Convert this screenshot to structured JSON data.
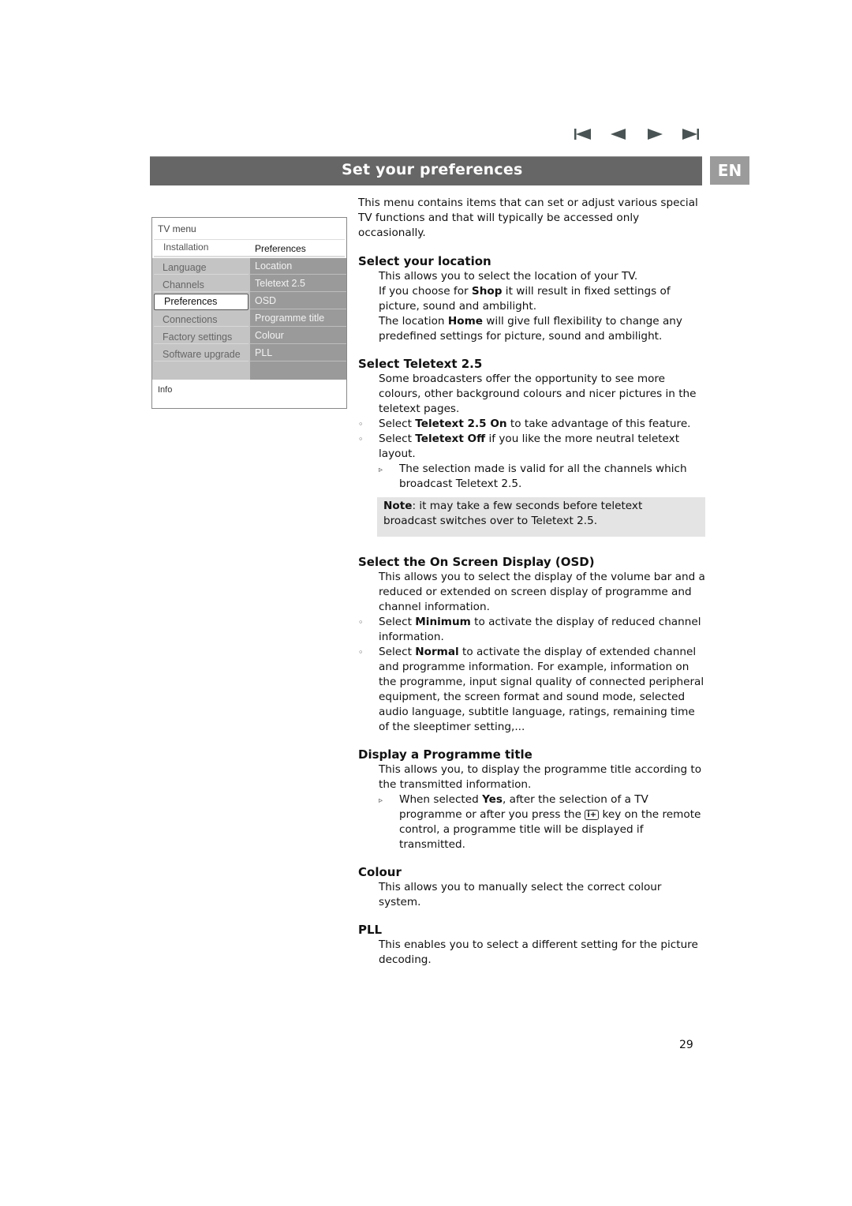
{
  "nav": {
    "icons": [
      "first-page-icon",
      "previous-page-icon",
      "next-page-icon",
      "last-page-icon"
    ]
  },
  "header": {
    "title": "Set your preferences",
    "language": "EN"
  },
  "tv_menu": {
    "title": "TV menu",
    "left_header": "Installation",
    "right_header": "Preferences",
    "left_items": [
      "Language",
      "Channels",
      "Preferences",
      "Connections",
      "Factory settings",
      "Software upgrade"
    ],
    "selected_left": "Preferences",
    "right_items": [
      "Location",
      "Teletext 2.5",
      "OSD",
      "Programme title",
      "Colour",
      "PLL"
    ],
    "info_label": "Info"
  },
  "content": {
    "intro": "This menu contains items that can set or adjust various special TV functions and that will typically be accessed only occasionally.",
    "location": {
      "heading": "Select your location",
      "line1": "This allows you to select the location of your TV.",
      "line2_pre": "If you choose for ",
      "line2_bold": "Shop",
      "line2_post": " it will result in fixed settings of picture, sound and ambilight.",
      "line3_pre": "The location ",
      "line3_bold": "Home",
      "line3_post": " will give full flexibility to change any predefined settings for picture, sound and ambilight."
    },
    "teletext": {
      "heading": "Select Teletext 2.5",
      "desc": "Some broadcasters offer the opportunity to see more colours, other background colours and nicer pictures in the teletext pages.",
      "b1_pre": "Select ",
      "b1_bold": "Teletext 2.5 On",
      "b1_post": " to take advantage of this feature.",
      "b2_pre": "Select ",
      "b2_bold": "Teletext Off",
      "b2_post": " if you like the more neutral teletext layout.",
      "sub": "The selection made is valid for all the channels which broadcast Teletext 2.5.",
      "note_bold": "Note",
      "note_text": ": it may take a few seconds before teletext broadcast switches over to Teletext 2.5."
    },
    "osd": {
      "heading": "Select the On Screen Display (OSD)",
      "desc": "This allows you to select the display of the volume bar and a reduced or extended on screen display of programme and channel information.",
      "b1_pre": "Select ",
      "b1_bold": "Minimum",
      "b1_post": " to activate the display of reduced channel information.",
      "b2_pre": "Select ",
      "b2_bold": "Normal",
      "b2_post": " to activate the display of extended channel and programme information. For example, information on the programme, input signal quality of connected peripheral equipment, the screen format and sound mode, selected audio language, subtitle language, ratings, remaining time of the sleeptimer setting,..."
    },
    "programme_title": {
      "heading": "Display a Programme title",
      "desc": "This allows you, to display the programme title according to the transmitted information.",
      "sub_pre": "When selected ",
      "sub_bold": "Yes",
      "sub_mid": ", after the selection of a TV programme or after you press the ",
      "key_label": "i+",
      "sub_post": " key on the remote control, a  programme title will be displayed if transmitted."
    },
    "colour": {
      "heading": "Colour",
      "desc": "This allows you to manually select the correct colour system."
    },
    "pll": {
      "heading": "PLL",
      "desc": "This enables you to select a different setting for the picture decoding."
    }
  },
  "markers": {
    "bullet": "◦",
    "arrow": "▹"
  },
  "page_number": "29"
}
